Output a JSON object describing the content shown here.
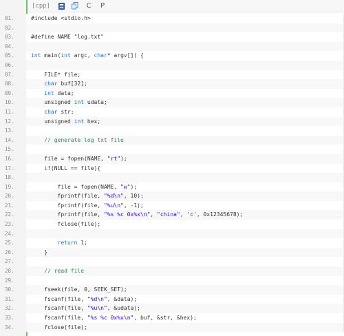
{
  "toolbar": {
    "language": "[cpp]",
    "icons": [
      "view-source-icon",
      "copy-icon",
      "c-icon",
      "p-icon"
    ],
    "icon_glyphs": {
      "c": "C",
      "p": "P"
    }
  },
  "colors": {
    "gutter_accent": "#6ac36a",
    "keyword": "#1d6fd1",
    "string": "#2a00ff",
    "comment": "#2e8b57"
  },
  "lines": [
    {
      "num": "01.",
      "tokens": [
        [
          "pp",
          "#include <stdio.h>"
        ]
      ]
    },
    {
      "num": "02.",
      "tokens": []
    },
    {
      "num": "03.",
      "tokens": [
        [
          "pp",
          "#define NAME \"log.txt\""
        ]
      ]
    },
    {
      "num": "04.",
      "tokens": []
    },
    {
      "num": "05.",
      "tokens": [
        [
          "kw",
          "int"
        ],
        [
          "t",
          " main("
        ],
        [
          "kw",
          "int"
        ],
        [
          "t",
          " argc, "
        ],
        [
          "kw",
          "char"
        ],
        [
          "t",
          "* argv[]) {"
        ]
      ]
    },
    {
      "num": "06.",
      "tokens": []
    },
    {
      "num": "07.",
      "tokens": [
        [
          "t",
          "    FILE* file;"
        ]
      ]
    },
    {
      "num": "08.",
      "tokens": [
        [
          "t",
          "    "
        ],
        [
          "kw",
          "char"
        ],
        [
          "t",
          " buf[32];"
        ]
      ]
    },
    {
      "num": "09.",
      "tokens": [
        [
          "t",
          "    "
        ],
        [
          "kw",
          "int"
        ],
        [
          "t",
          " data;"
        ]
      ]
    },
    {
      "num": "10.",
      "tokens": [
        [
          "t",
          "    unsigned "
        ],
        [
          "kw",
          "int"
        ],
        [
          "t",
          " udata;"
        ]
      ]
    },
    {
      "num": "11.",
      "tokens": [
        [
          "t",
          "    "
        ],
        [
          "kw",
          "char"
        ],
        [
          "t",
          " str;"
        ]
      ]
    },
    {
      "num": "12.",
      "tokens": [
        [
          "t",
          "    unsigned "
        ],
        [
          "kw",
          "int"
        ],
        [
          "t",
          " hex;"
        ]
      ]
    },
    {
      "num": "13.",
      "tokens": []
    },
    {
      "num": "14.",
      "tokens": [
        [
          "cm",
          "    // generate log txt file"
        ]
      ]
    },
    {
      "num": "15.",
      "tokens": []
    },
    {
      "num": "16.",
      "tokens": [
        [
          "t",
          "    file = fopen(NAME, "
        ],
        [
          "str",
          "\"rt\""
        ],
        [
          "t",
          ");"
        ]
      ]
    },
    {
      "num": "17.",
      "tokens": [
        [
          "t",
          "    "
        ],
        [
          "kw",
          "if"
        ],
        [
          "t",
          "(NULL == file){"
        ]
      ]
    },
    {
      "num": "18.",
      "tokens": []
    },
    {
      "num": "19.",
      "tokens": [
        [
          "t",
          "        file = fopen(NAME, "
        ],
        [
          "str",
          "\"w\""
        ],
        [
          "t",
          ");"
        ]
      ]
    },
    {
      "num": "20.",
      "tokens": [
        [
          "t",
          "        fprintf(file, "
        ],
        [
          "str",
          "\"%d\\n\""
        ],
        [
          "t",
          ", 10);"
        ]
      ]
    },
    {
      "num": "21.",
      "tokens": [
        [
          "t",
          "        fprintf(file, "
        ],
        [
          "str",
          "\"%u\\n\""
        ],
        [
          "t",
          ", -1);"
        ]
      ]
    },
    {
      "num": "22.",
      "tokens": [
        [
          "t",
          "        fprintf(file, "
        ],
        [
          "str",
          "\"%s %c 0x%x\\n\""
        ],
        [
          "t",
          ", "
        ],
        [
          "str",
          "\"china\""
        ],
        [
          "t",
          ", "
        ],
        [
          "str",
          "'c'"
        ],
        [
          "t",
          ", 0x12345678);"
        ]
      ]
    },
    {
      "num": "23.",
      "tokens": [
        [
          "t",
          "        fclose(file);"
        ]
      ]
    },
    {
      "num": "24.",
      "tokens": []
    },
    {
      "num": "25.",
      "tokens": [
        [
          "t",
          "        "
        ],
        [
          "kw",
          "return"
        ],
        [
          "t",
          " 1;"
        ]
      ]
    },
    {
      "num": "26.",
      "tokens": [
        [
          "t",
          "    }"
        ]
      ]
    },
    {
      "num": "27.",
      "tokens": []
    },
    {
      "num": "28.",
      "tokens": [
        [
          "cm",
          "    // read file"
        ]
      ]
    },
    {
      "num": "29.",
      "tokens": []
    },
    {
      "num": "30.",
      "tokens": [
        [
          "t",
          "    fseek(file, 0, SEEK_SET);"
        ]
      ]
    },
    {
      "num": "31.",
      "tokens": [
        [
          "t",
          "    fscanf(file, "
        ],
        [
          "str",
          "\"%d\\n\""
        ],
        [
          "t",
          ", &data);"
        ]
      ]
    },
    {
      "num": "32.",
      "tokens": [
        [
          "t",
          "    fscanf(file, "
        ],
        [
          "str",
          "\"%u\\n\""
        ],
        [
          "t",
          ", &udata);"
        ]
      ]
    },
    {
      "num": "33.",
      "tokens": [
        [
          "t",
          "    fscanf(file, "
        ],
        [
          "str",
          "\"%s %c 0x%x\\n\""
        ],
        [
          "t",
          ", buf, &str, &hex);"
        ]
      ]
    },
    {
      "num": "34.",
      "tokens": [
        [
          "t",
          "    fclose(file);"
        ]
      ]
    }
  ]
}
